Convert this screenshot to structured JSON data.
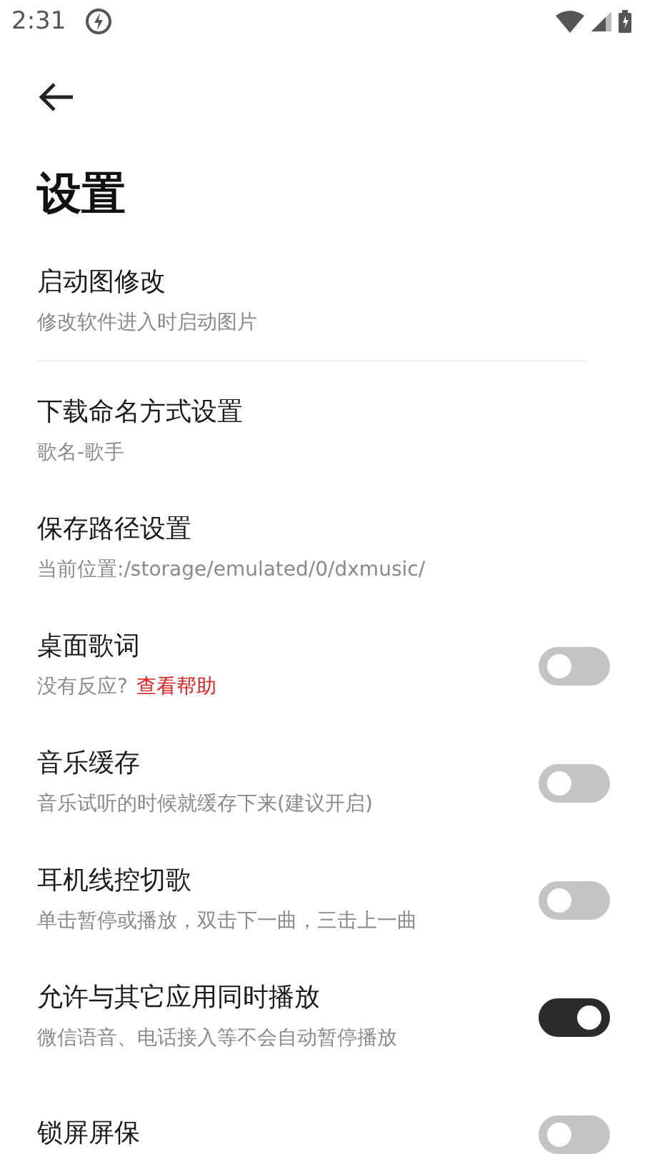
{
  "status_bar": {
    "time": "2:31"
  },
  "title": "设置",
  "items": [
    {
      "kind": "plain",
      "title": "启动图修改",
      "subtitle": "修改软件进入时启动图片",
      "divider_after": true
    },
    {
      "kind": "plain",
      "title": "下载命名方式设置",
      "subtitle": "歌名-歌手"
    },
    {
      "kind": "plain",
      "title": "保存路径设置",
      "subtitle": "当前位置:/storage/emulated/0/dxmusic/"
    },
    {
      "kind": "toggle",
      "title": "桌面歌词",
      "subtitle": "没有反应?",
      "link": "查看帮助",
      "on": false
    },
    {
      "kind": "toggle",
      "title": "音乐缓存",
      "subtitle": "音乐试听的时候就缓存下来(建议开启)",
      "on": false
    },
    {
      "kind": "toggle",
      "title": "耳机线控切歌",
      "subtitle": "单击暂停或播放，双击下一曲，三击上一曲",
      "on": false
    },
    {
      "kind": "toggle",
      "title": "允许与其它应用同时播放",
      "subtitle": "微信语音、电话接入等不会自动暂停播放",
      "on": true
    },
    {
      "kind": "toggle",
      "title": "锁屏屏保",
      "on": false
    }
  ]
}
